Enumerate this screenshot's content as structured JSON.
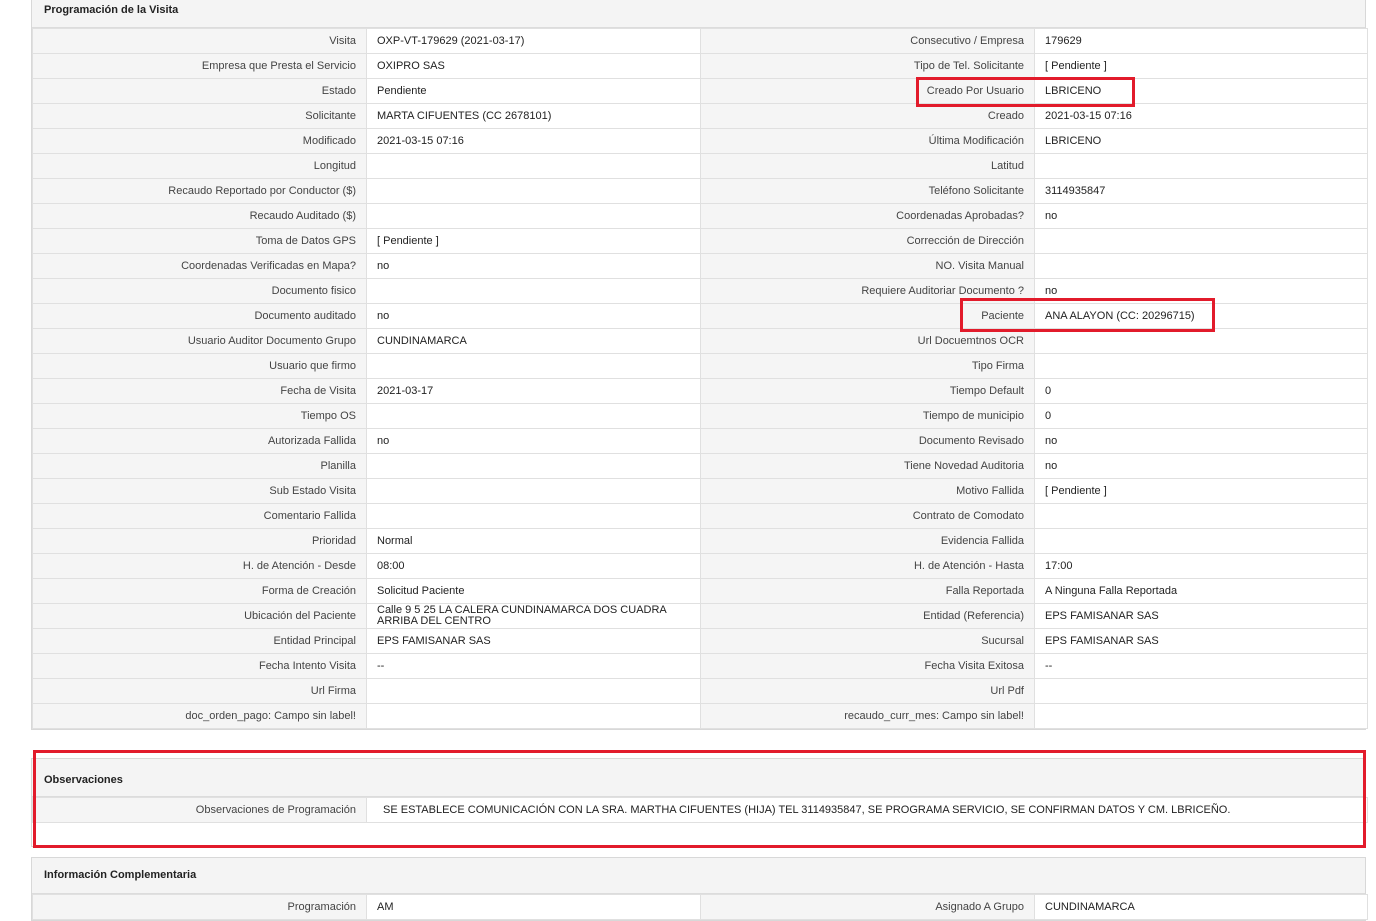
{
  "sections": {
    "programacion": {
      "title": "Programación de la Visita",
      "rows": [
        [
          "Visita",
          "OXP-VT-179629 (2021-03-17)",
          "Consecutivo / Empresa",
          "179629"
        ],
        [
          "Empresa que Presta el Servicio",
          "OXIPRO SAS",
          "Tipo de Tel. Solicitante",
          "[ Pendiente ]"
        ],
        [
          "Estado",
          "Pendiente",
          "Creado Por Usuario",
          "LBRICENO"
        ],
        [
          "Solicitante",
          "MARTA CIFUENTES (CC 2678101)",
          "Creado",
          "2021-03-15 07:16"
        ],
        [
          "Modificado",
          "2021-03-15 07:16",
          "Última Modificación",
          " LBRICENO"
        ],
        [
          "Longitud",
          "",
          "Latitud",
          ""
        ],
        [
          "Recaudo Reportado por Conductor ($)",
          "",
          "Teléfono Solicitante",
          "3114935847"
        ],
        [
          "Recaudo Auditado ($)",
          "",
          "Coordenadas Aprobadas?",
          " no"
        ],
        [
          "Toma de Datos GPS",
          "[ Pendiente ]",
          "Corrección de Dirección",
          ""
        ],
        [
          "Coordenadas Verificadas en Mapa?",
          " no",
          "NO. Visita Manual",
          ""
        ],
        [
          "Documento fisico",
          "",
          "Requiere Auditoriar Documento ?",
          " no"
        ],
        [
          "Documento auditado",
          " no",
          "Paciente",
          "ANA ALAYON (CC: 20296715)"
        ],
        [
          "Usuario Auditor Documento Grupo",
          "CUNDINAMARCA",
          "Url Docuemtnos OCR",
          ""
        ],
        [
          "Usuario que firmo",
          "",
          "Tipo Firma",
          ""
        ],
        [
          "Fecha de Visita",
          " 2021-03-17",
          "Tiempo Default",
          "0"
        ],
        [
          "Tiempo OS",
          "",
          "Tiempo de municipio",
          "0"
        ],
        [
          "Autorizada Fallida",
          " no",
          "Documento Revisado",
          " no"
        ],
        [
          "Planilla",
          "",
          "Tiene Novedad Auditoria",
          " no"
        ],
        [
          "Sub Estado Visita",
          "",
          "Motivo Fallida",
          "[ Pendiente ]"
        ],
        [
          "Comentario Fallida",
          "",
          "Contrato de Comodato",
          ""
        ],
        [
          "Prioridad",
          "Normal",
          "Evidencia Fallida",
          ""
        ],
        [
          "H. de Atención - Desde",
          "08:00",
          "H. de Atención - Hasta",
          "17:00"
        ],
        [
          "Forma de Creación",
          "Solicitud Paciente",
          "Falla Reportada",
          "A Ninguna Falla Reportada"
        ],
        [
          "Ubicación del Paciente",
          "Calle 9 5 25 LA CALERA CUNDINAMARCA DOS CUADRA ARRIBA DEL CENTRO",
          "Entidad (Referencia)",
          "EPS FAMISANAR SAS"
        ],
        [
          "Entidad Principal",
          "EPS FAMISANAR SAS",
          "Sucursal",
          "EPS FAMISANAR SAS"
        ],
        [
          "Fecha Intento Visita",
          " --",
          "Fecha Visita Exitosa",
          " --"
        ],
        [
          "Url Firma",
          "",
          "Url Pdf",
          ""
        ],
        [
          "doc_orden_pago: Campo sin label!",
          "",
          "recaudo_curr_mes: Campo sin label!",
          ""
        ]
      ]
    },
    "observaciones": {
      "title": "Observaciones",
      "label": "Observaciones de Programación",
      "value": "SE ESTABLECE COMUNICACIÓN CON LA SRA. MARTHA CIFUENTES (HIJA) TEL 3114935847, SE PROGRAMA SERVICIO, SE CONFIRMAN DATOS Y CM. LBRICEÑO."
    },
    "complementaria": {
      "title": "Información Complementaria",
      "rows": [
        [
          "Programación",
          "AM",
          "Asignado A Grupo",
          "CUNDINAMARCA"
        ]
      ]
    }
  },
  "highlight_color": "#e21b2b"
}
